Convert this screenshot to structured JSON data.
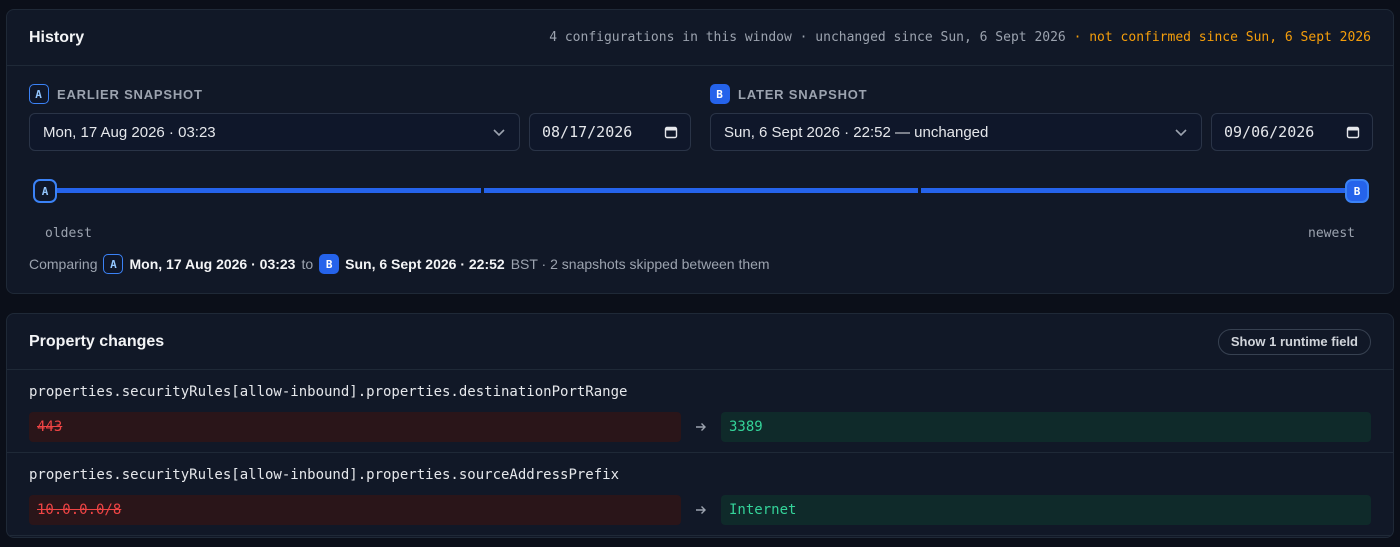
{
  "history": {
    "title": "History",
    "meta": "4 configurations in this window · unchanged since Sun, 6 Sept 2026",
    "meta_warning": " · not confirmed since Sun, 6 Sept 2026",
    "snapshot_a": {
      "badge": "A",
      "label": "EARLIER SNAPSHOT",
      "selected": "Mon, 17 Aug 2026 · 03:23",
      "date": "08/17/2026"
    },
    "snapshot_b": {
      "badge": "B",
      "label": "LATER SNAPSHOT",
      "selected": "Sun, 6 Sept 2026 · 22:52 — unchanged",
      "date": "09/06/2026"
    },
    "timeline": {
      "oldest_label": "oldest",
      "newest_label": "newest",
      "handle_a": "A",
      "handle_b": "B"
    },
    "compare": {
      "prefix": "Comparing",
      "a_badge": "A",
      "a_value": "Mon, 17 Aug 2026 · 03:23",
      "to": "to",
      "b_badge": "B",
      "b_value": "Sun, 6 Sept 2026 · 22:52",
      "suffix": "BST · 2 snapshots skipped between them"
    }
  },
  "changes": {
    "title": "Property changes",
    "runtime_button": "Show 1 runtime field",
    "rows": [
      {
        "path": "properties.securityRules[allow-inbound].properties.destinationPortRange",
        "old": "443",
        "new": "3389"
      },
      {
        "path": "properties.securityRules[allow-inbound].properties.sourceAddressPrefix",
        "old": "10.0.0.0/8",
        "new": "Internet"
      }
    ]
  },
  "icons": {
    "select_chevron": "chevron-down-icon",
    "date_picker": "calendar-icon",
    "diff_arrow": "arrow-right-icon"
  }
}
